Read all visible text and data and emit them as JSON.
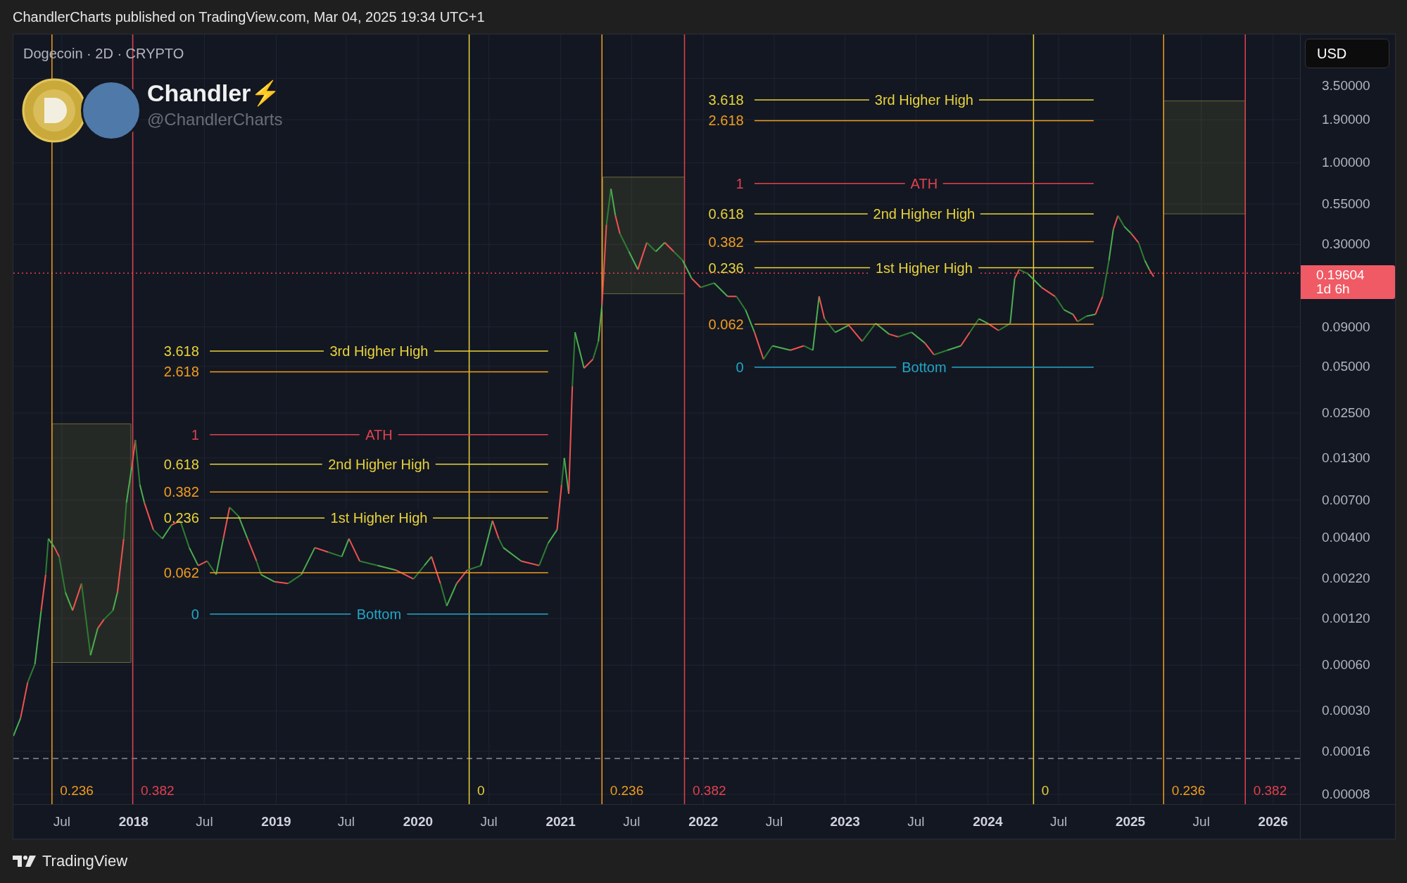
{
  "header": {
    "publish_line": "ChandlerCharts published on TradingView.com, Mar 04, 2025 19:34 UTC+1"
  },
  "chart": {
    "symbol_line": "Dogecoin · 2D · CRYPTO",
    "author": {
      "name": "Chandler⚡",
      "handle": "@ChandlerCharts"
    },
    "currency_button": "USD",
    "price_ticks": [
      "3.50000",
      "1.90000",
      "1.00000",
      "0.55000",
      "0.30000",
      "0.09000",
      "0.05000",
      "0.02500",
      "0.01300",
      "0.00700",
      "0.00400",
      "0.00220",
      "0.00120",
      "0.00060",
      "0.00030",
      "0.00016",
      "0.00008"
    ],
    "current_price": {
      "value": "0.19604",
      "countdown": "1d 6h"
    },
    "time_ticks": [
      {
        "label": "Jul",
        "kind": "month"
      },
      {
        "label": "2018",
        "kind": "year"
      },
      {
        "label": "Jul",
        "kind": "month"
      },
      {
        "label": "2019",
        "kind": "year"
      },
      {
        "label": "Jul",
        "kind": "month"
      },
      {
        "label": "2020",
        "kind": "year"
      },
      {
        "label": "Jul",
        "kind": "month"
      },
      {
        "label": "2021",
        "kind": "year"
      },
      {
        "label": "Jul",
        "kind": "month"
      },
      {
        "label": "2022",
        "kind": "year"
      },
      {
        "label": "Jul",
        "kind": "month"
      },
      {
        "label": "2023",
        "kind": "year"
      },
      {
        "label": "Jul",
        "kind": "month"
      },
      {
        "label": "2024",
        "kind": "year"
      },
      {
        "label": "Jul",
        "kind": "month"
      },
      {
        "label": "2025",
        "kind": "year"
      },
      {
        "label": "Jul",
        "kind": "month"
      },
      {
        "label": "2026",
        "kind": "year"
      }
    ],
    "time_markers": [
      {
        "label": "0.236",
        "color": "#f29d1e"
      },
      {
        "label": "0.382",
        "color": "#e0424f"
      },
      {
        "label": "0",
        "color": "#e8d33a"
      },
      {
        "label": "0.236",
        "color": "#f29d1e"
      },
      {
        "label": "0.382",
        "color": "#e0424f"
      },
      {
        "label": "0",
        "color": "#e8d33a"
      },
      {
        "label": "0.236",
        "color": "#f29d1e"
      },
      {
        "label": "0.382",
        "color": "#e0424f"
      }
    ],
    "fib_sets": [
      {
        "levels": [
          {
            "value": "3.618",
            "label": "3rd Higher High",
            "color": "#e8d33a"
          },
          {
            "value": "2.618",
            "color": "#f29d1e"
          },
          {
            "value": "1",
            "label": "ATH",
            "color": "#e0424f"
          },
          {
            "value": "0.618",
            "label": "2nd Higher High",
            "color": "#e8d33a"
          },
          {
            "value": "0.382",
            "color": "#f29d1e"
          },
          {
            "value": "0.236",
            "label": "1st Higher High",
            "color": "#e8d33a"
          },
          {
            "value": "0.062",
            "color": "#f29d1e"
          },
          {
            "value": "0",
            "label": "Bottom",
            "color": "#21a7c8"
          }
        ]
      },
      {
        "levels": [
          {
            "value": "3.618",
            "label": "3rd Higher High",
            "color": "#e8d33a"
          },
          {
            "value": "2.618",
            "color": "#f29d1e"
          },
          {
            "value": "1",
            "label": "ATH",
            "color": "#e0424f"
          },
          {
            "value": "0.618",
            "label": "2nd Higher High",
            "color": "#e8d33a"
          },
          {
            "value": "0.382",
            "color": "#f29d1e"
          },
          {
            "value": "0.236",
            "label": "1st Higher High",
            "color": "#e8d33a"
          },
          {
            "value": "0.062",
            "color": "#f29d1e"
          },
          {
            "value": "0",
            "label": "Bottom",
            "color": "#21a7c8"
          }
        ]
      }
    ]
  },
  "footer": {
    "brand": "TradingView"
  }
}
